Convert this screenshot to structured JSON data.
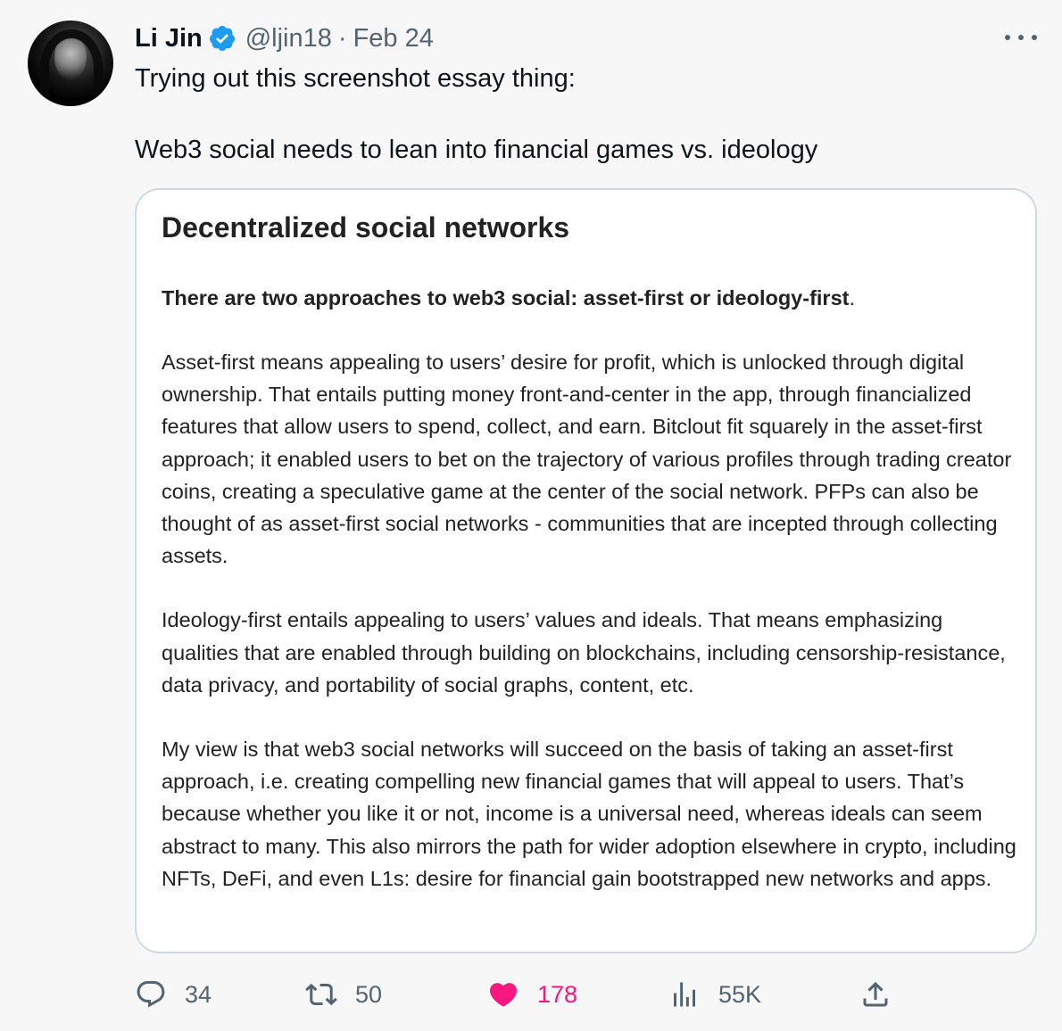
{
  "author": {
    "name": "Li Jin",
    "handle": "@ljin18",
    "separator": "·",
    "date": "Feb 24"
  },
  "tweet": {
    "line1": "Trying out this screenshot essay thing:",
    "line2": "Web3 social needs to lean into financial games vs. ideology"
  },
  "card": {
    "title": "Decentralized social networks",
    "lead_bold": "There are two approaches to web3 social: asset-first or ideology-first",
    "lead_end": ".",
    "para1": "Asset-first means appealing to users’ desire for profit, which is unlocked through digital ownership. That entails putting money front-and-center in the app, through financialized features that allow users to spend, collect, and earn. Bitclout fit squarely in the asset-first approach; it enabled users to bet on the trajectory of various profiles through trading creator coins, creating a speculative game at the center of the social network. PFPs can also be thought of as asset-first social networks - communities that are incepted through collecting assets.",
    "para2": "Ideology-first entails appealing to users’ values and ideals. That means emphasizing qualities that are enabled through building on blockchains, including censorship-resistance, data privacy, and portability of social graphs, content, etc.",
    "para3": "My view is that web3 social networks will succeed on the basis of taking an asset-first approach, i.e. creating compelling new financial games that will appeal to users. That’s because whether you like it or not, income is a universal need, whereas ideals can seem abstract to many. This also mirrors the path for wider adoption elsewhere in crypto, including NFTs, DeFi, and even L1s: desire for financial gain bootstrapped new networks and apps."
  },
  "actions": {
    "replies": "34",
    "retweets": "50",
    "likes": "178",
    "views": "55K"
  },
  "icons": {
    "verified": "verified-badge-icon",
    "more": "more-dots-icon",
    "reply": "reply-bubble-icon",
    "retweet": "retweet-icon",
    "like": "heart-icon",
    "views": "views-chart-icon",
    "share": "share-icon"
  },
  "colors": {
    "accent_blue": "#1d9bf0",
    "like_pink": "#f91880",
    "muted": "#536471",
    "text": "#0f1419",
    "card_border": "#cfd9de"
  }
}
